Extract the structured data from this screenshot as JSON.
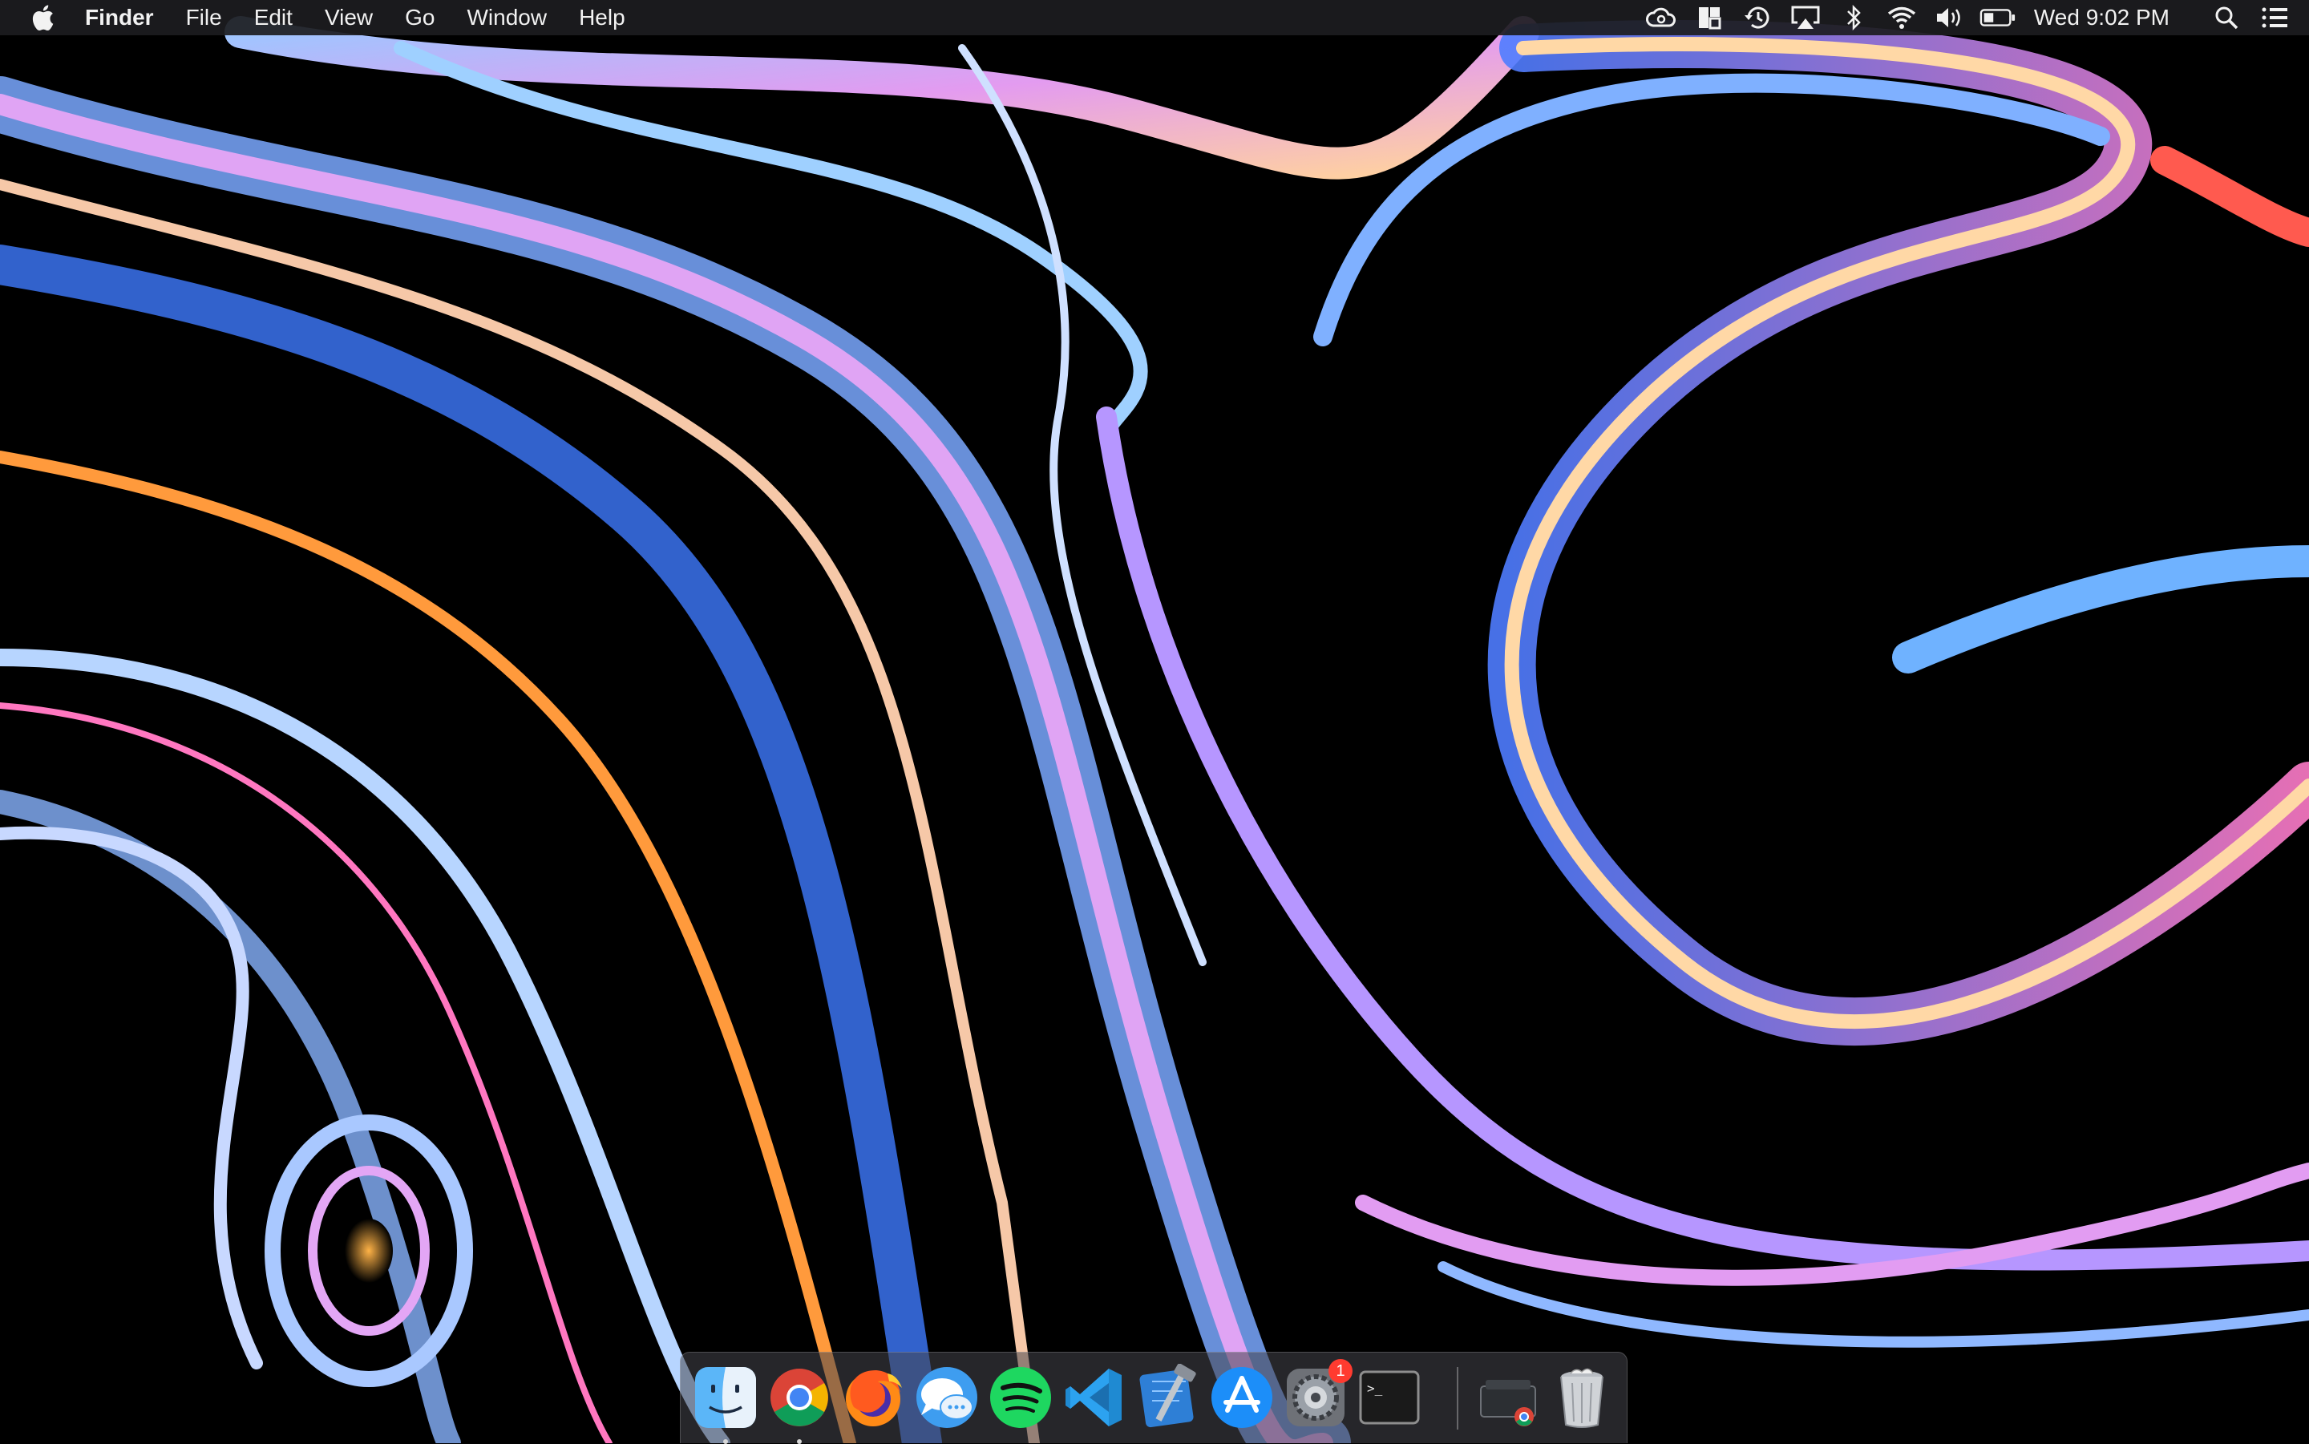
{
  "menubar": {
    "apple_icon": "apple-logo",
    "app_name": "Finder",
    "menus": [
      "File",
      "Edit",
      "View",
      "Go",
      "Window",
      "Help"
    ],
    "status_icons": [
      "creative-cloud-icon",
      "window-manager-icon",
      "time-machine-icon",
      "airplay-icon",
      "bluetooth-icon",
      "wifi-icon",
      "volume-icon",
      "battery-icon"
    ],
    "clock": "Wed 9:02 PM",
    "right_icons": [
      "spotlight-search-icon",
      "notification-center-icon"
    ]
  },
  "dock": {
    "apps": [
      {
        "name": "Finder",
        "icon": "finder-icon",
        "running": true
      },
      {
        "name": "Google Chrome",
        "icon": "chrome-icon",
        "running": true
      },
      {
        "name": "Firefox",
        "icon": "firefox-icon",
        "running": false
      },
      {
        "name": "Messages",
        "icon": "messages-icon",
        "running": false
      },
      {
        "name": "Spotify",
        "icon": "spotify-icon",
        "running": false
      },
      {
        "name": "Visual Studio Code",
        "icon": "vscode-icon",
        "running": false
      },
      {
        "name": "Xcode",
        "icon": "xcode-icon",
        "running": false
      },
      {
        "name": "App Store",
        "icon": "app-store-icon",
        "running": false
      },
      {
        "name": "System Preferences",
        "icon": "system-preferences-icon",
        "running": false,
        "badge": "1"
      },
      {
        "name": "Terminal",
        "icon": "terminal-icon",
        "running": false
      }
    ],
    "others": [
      {
        "name": "Downloads stack",
        "icon": "downloads-stack-icon"
      },
      {
        "name": "Trash",
        "icon": "trash-icon"
      }
    ],
    "terminal_prompt": ">_"
  },
  "colors": {
    "menubar_bg": "#1c1c20",
    "wallpaper_bg": "#000000",
    "badge": "#ff3b30"
  }
}
